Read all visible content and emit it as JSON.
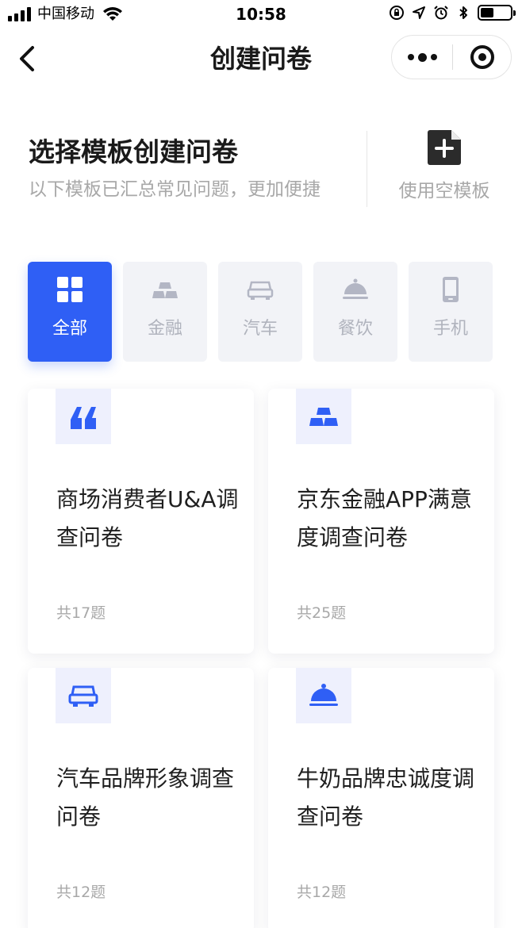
{
  "status_bar": {
    "carrier": "中国移动",
    "time": "10:58",
    "icons": [
      "signal-icon",
      "wifi-icon",
      "orientation-lock-icon",
      "location-icon",
      "alarm-icon",
      "bluetooth-icon",
      "battery-icon"
    ]
  },
  "nav": {
    "title": "创建问卷",
    "back_icon": "chevron-left-icon",
    "more_icon": "more-dots-icon",
    "close_icon": "mini-program-close-icon"
  },
  "intro": {
    "title": "选择模板创建问卷",
    "subtitle": "以下模板已汇总常见问题，更加便捷",
    "blank_template_label": "使用空模板",
    "blank_template_icon": "add-document-icon"
  },
  "tabs": [
    {
      "label": "全部",
      "icon": "grid-icon",
      "active": true
    },
    {
      "label": "金融",
      "icon": "gold-bars-icon",
      "active": false
    },
    {
      "label": "汽车",
      "icon": "car-icon",
      "active": false
    },
    {
      "label": "餐饮",
      "icon": "cloche-icon",
      "active": false
    },
    {
      "label": "手机",
      "icon": "phone-icon",
      "active": false
    }
  ],
  "cards": [
    {
      "title": "商场消费者U&A调查问卷",
      "count": "共17题",
      "icon": "quote-icon"
    },
    {
      "title": "京东金融APP满意度调查问卷",
      "count": "共25题",
      "icon": "gold-bars-icon"
    },
    {
      "title": "汽车品牌形象调查问卷",
      "count": "共12题",
      "icon": "car-icon"
    },
    {
      "title": "牛奶品牌忠诚度调查问卷",
      "count": "共12题",
      "icon": "cloche-icon"
    }
  ],
  "colors": {
    "accent": "#2f5ff5",
    "tab_bg": "#f2f3f7",
    "icon_box_bg": "#eef0fd",
    "muted_text": "#a8a8a8",
    "inactive_icon": "#b3b6c4"
  }
}
